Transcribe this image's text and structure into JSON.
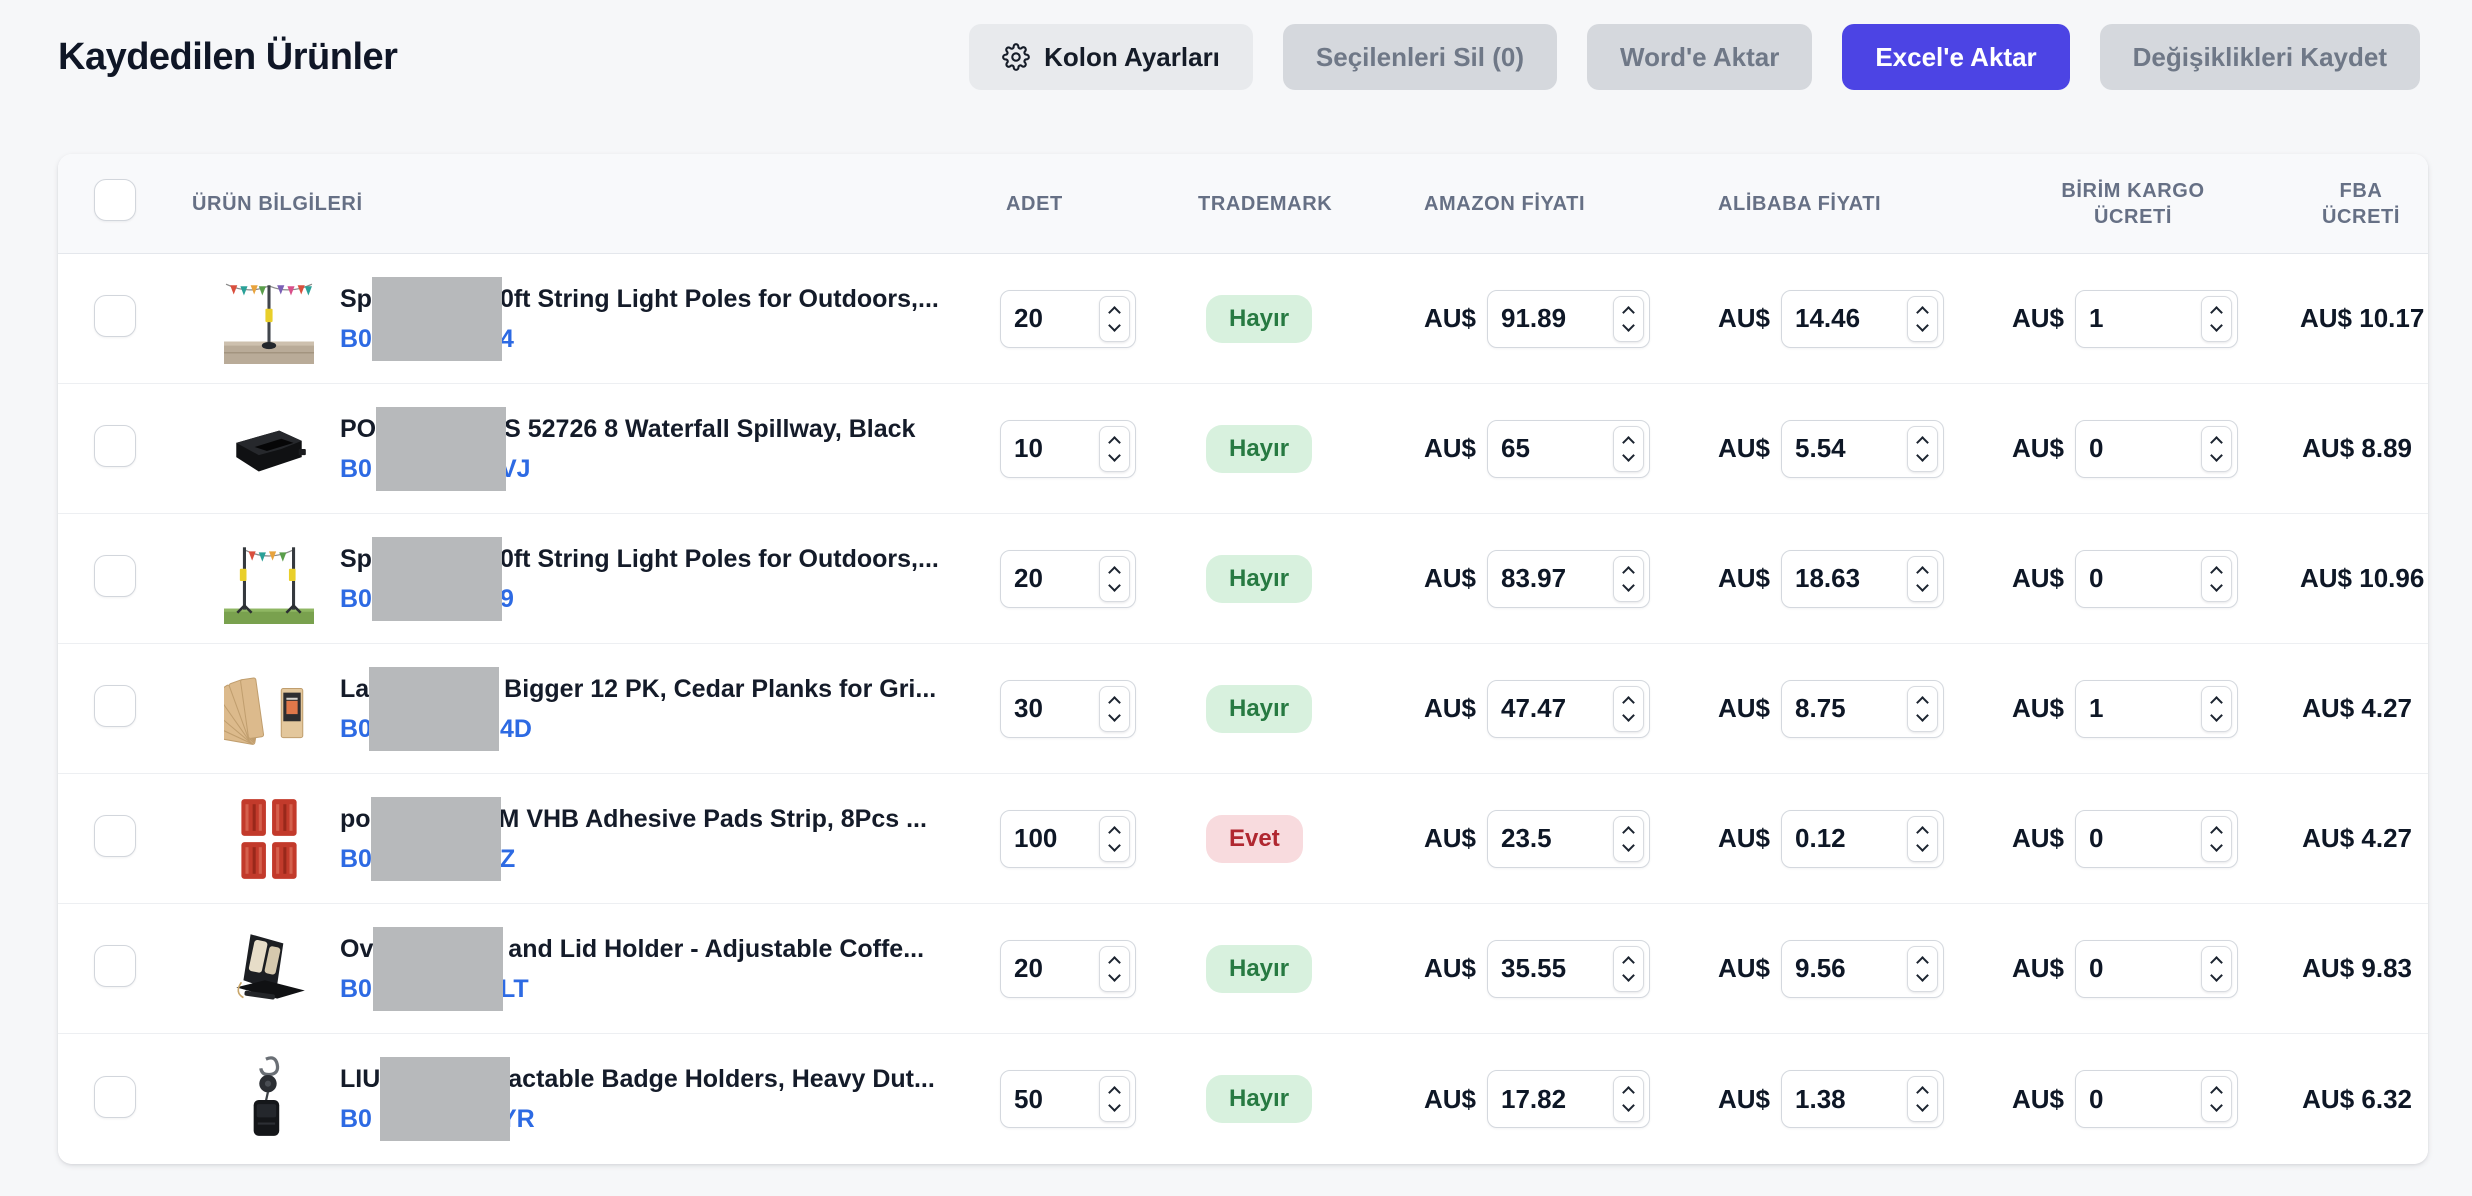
{
  "page": {
    "title": "Kaydedilen Ürünler"
  },
  "toolbar": {
    "buttons": [
      {
        "name": "column-settings-button",
        "label": "Kolon Ayarları",
        "style": "light",
        "icon": "gear"
      },
      {
        "name": "delete-selected-button",
        "label": "Seçilenleri Sil (0)",
        "style": "disabled",
        "icon": null
      },
      {
        "name": "export-word-button",
        "label": "Word'e Aktar",
        "style": "disabled",
        "icon": null
      },
      {
        "name": "export-excel-button",
        "label": "Excel'e Aktar",
        "style": "primary",
        "icon": null
      },
      {
        "name": "save-changes-button",
        "label": "Değişiklikleri Kaydet",
        "style": "disabled",
        "icon": null
      }
    ]
  },
  "colors": {
    "primary_button": "#4c44e4",
    "badge_no_bg": "#d8f1de",
    "badge_no_text": "#277a42",
    "badge_yes_bg": "#f8dbde",
    "badge_yes_text": "#b02730",
    "link": "#2d6ae3",
    "redaction": "#b7b9bb"
  },
  "table": {
    "headers": {
      "product": "ÜRÜN BİLGİLERİ",
      "qty": "ADET",
      "trademark": "TRADEMARK",
      "amazon": "AMAZON FİYATI",
      "alibaba": "ALİBABA FİYATI",
      "shipping_line1": "BİRİM KARGO",
      "shipping_line2": "ÜCRETİ",
      "fba_line1": "FBA",
      "fba_line2": "ÜCRETİ"
    },
    "currency": "AU$",
    "trademark_positive": "Evet",
    "rows": [
      {
        "image": "string-light-pole-icon",
        "title_prefix": "Sp",
        "title_suffix": "0ft String Light Poles for Outdoors,...",
        "link_prefix": "B0",
        "link_suffix": "4",
        "qty": "20",
        "trademark": "Hayır",
        "amazon": "91.89",
        "alibaba": "14.46",
        "shipping": "1",
        "fba": "10.17"
      },
      {
        "image": "waterfall-spillway-icon",
        "title_prefix": "PO",
        "title_suffix": "S 52726 8 Waterfall Spillway, Black",
        "link_prefix": "B0",
        "link_suffix": "VJ",
        "qty": "10",
        "trademark": "Hayır",
        "amazon": "65",
        "alibaba": "5.54",
        "shipping": "0",
        "fba": "8.89"
      },
      {
        "image": "string-light-poles-pair-icon",
        "title_prefix": "Sp",
        "title_suffix": "0ft String Light Poles for Outdoors,...",
        "link_prefix": "B0",
        "link_suffix": "9",
        "qty": "20",
        "trademark": "Hayır",
        "amazon": "83.97",
        "alibaba": "18.63",
        "shipping": "0",
        "fba": "10.96"
      },
      {
        "image": "cedar-planks-icon",
        "title_prefix": "La",
        "title_suffix": " Bigger 12 PK, Cedar Planks for Gri...",
        "link_prefix": "B0",
        "link_suffix": "4D",
        "qty": "30",
        "trademark": "Hayır",
        "amazon": "47.47",
        "alibaba": "8.75",
        "shipping": "1",
        "fba": "4.27"
      },
      {
        "image": "adhesive-pads-icon",
        "title_prefix": "po",
        "title_suffix": "M VHB Adhesive Pads Strip, 8Pcs ...",
        "link_prefix": "B0",
        "link_suffix": "Z",
        "qty": "100",
        "trademark": "Evet",
        "amazon": "23.5",
        "alibaba": "0.12",
        "shipping": "0",
        "fba": "4.27"
      },
      {
        "image": "cup-lid-holder-icon",
        "title_prefix": "Ov",
        "title_suffix": " and Lid Holder - Adjustable Coffe...",
        "link_prefix": "B0",
        "link_suffix": "LT",
        "qty": "20",
        "trademark": "Hayır",
        "amazon": "35.55",
        "alibaba": "9.56",
        "shipping": "0",
        "fba": "9.83"
      },
      {
        "image": "badge-holder-icon",
        "title_prefix": "LIU",
        "title_suffix": "actable Badge Holders, Heavy Dut...",
        "link_prefix": "B0",
        "link_suffix": "YR",
        "qty": "50",
        "trademark": "Hayır",
        "amazon": "17.82",
        "alibaba": "1.38",
        "shipping": "0",
        "fba": "6.32"
      }
    ]
  }
}
